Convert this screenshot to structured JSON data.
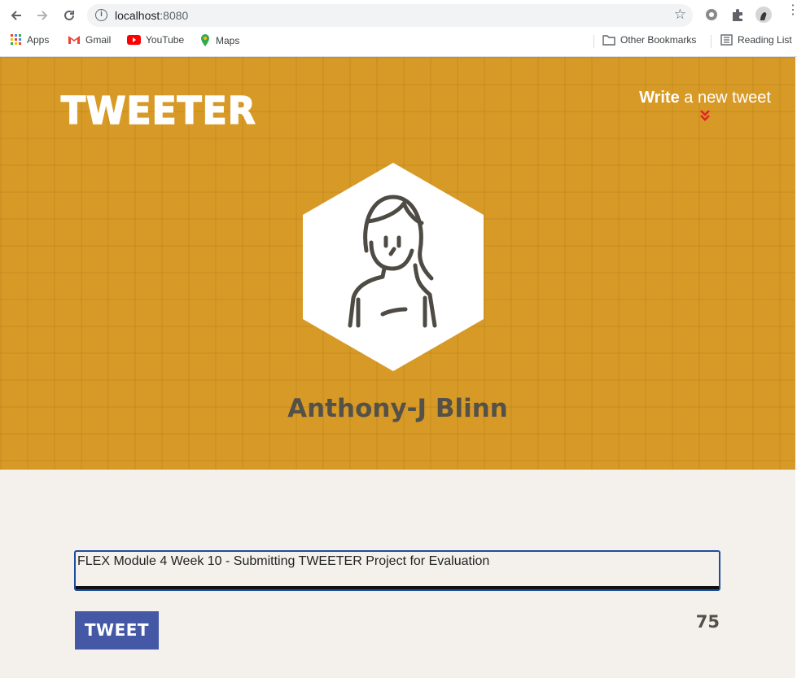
{
  "browser": {
    "url_host": "localhost",
    "url_port": ":8080",
    "bookmarks": [
      "Apps",
      "Gmail",
      "YouTube",
      "Maps"
    ],
    "other_bookmarks": "Other Bookmarks",
    "reading_list": "Reading List"
  },
  "header": {
    "logo": "TWEETER",
    "write_bold": "Write",
    "write_rest": " a new tweet",
    "username": "Anthony-J Blinn",
    "accent_color": "#d89a26"
  },
  "composer": {
    "value": "FLEX Module 4 Week 10 - Submitting TWEETER Project for Evaluation",
    "button_label": "TWEET",
    "counter": "75",
    "button_color": "#4458a6"
  }
}
